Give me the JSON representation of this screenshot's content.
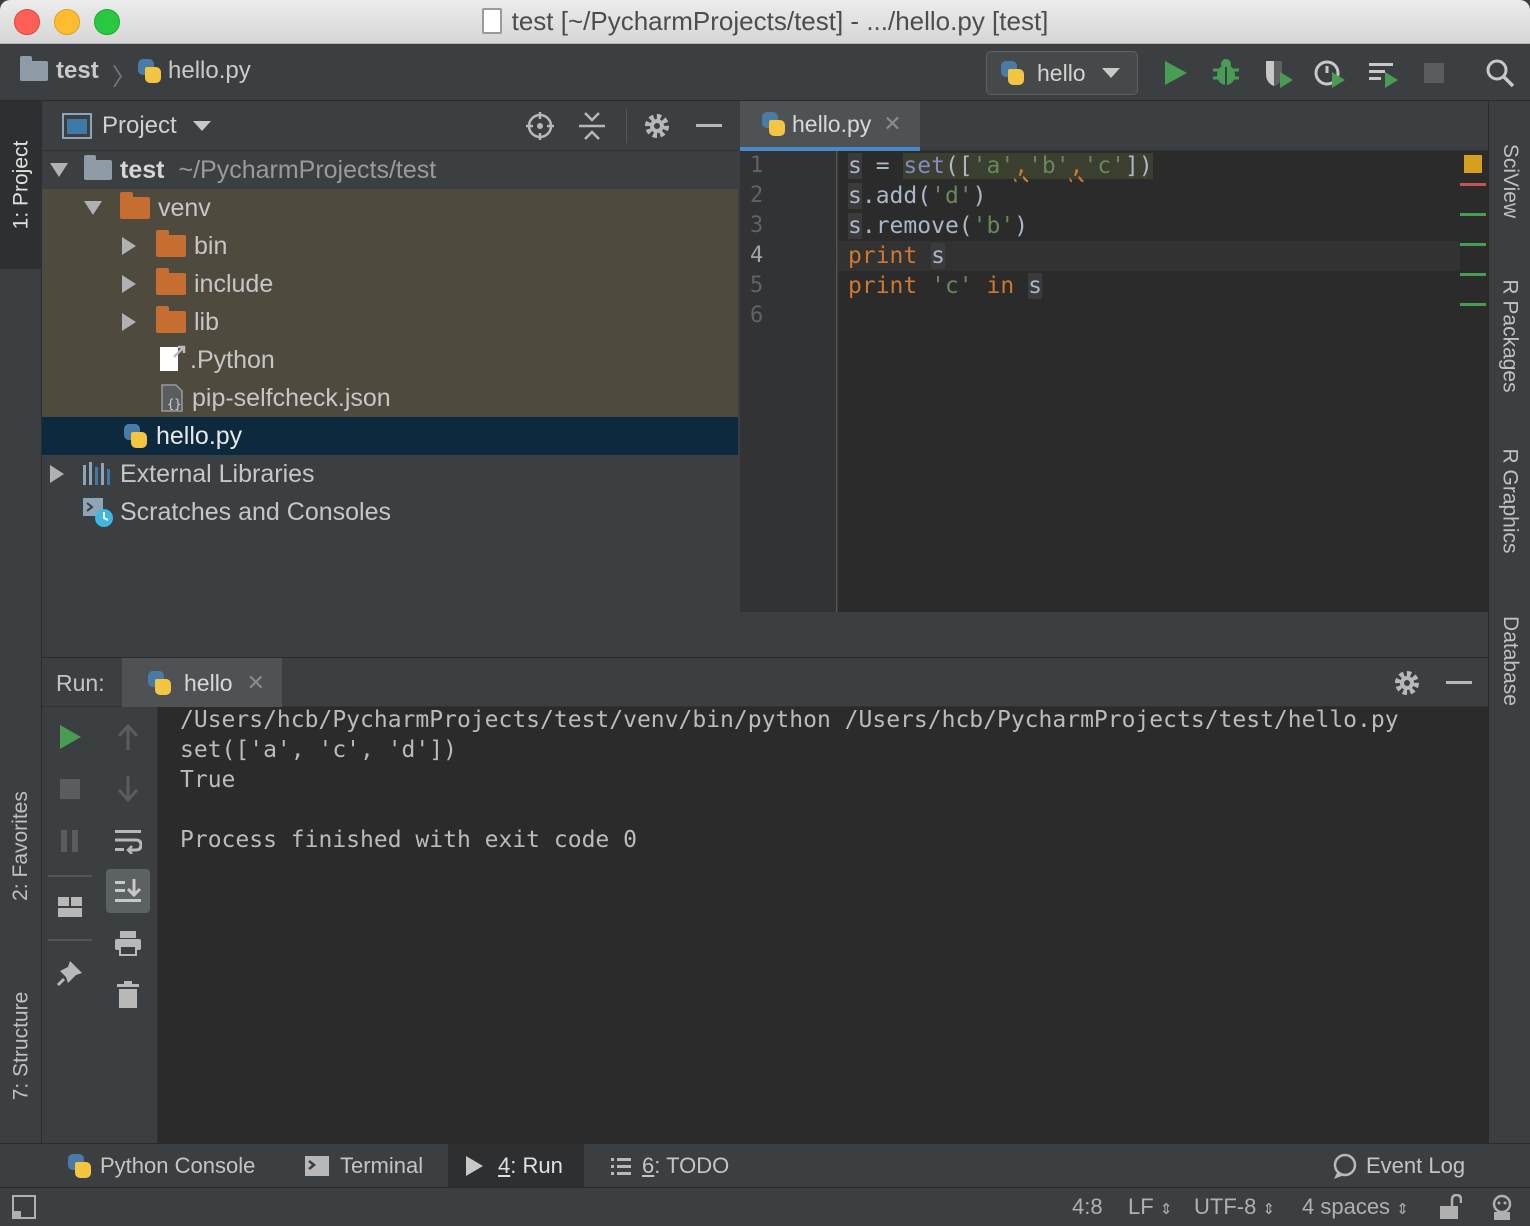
{
  "window": {
    "title": "test [~/PycharmProjects/test] - .../hello.py [test]"
  },
  "nav": {
    "project": "test",
    "file": "hello.py",
    "run_config": "hello"
  },
  "left_tabs": {
    "project": "1: Project",
    "favorites": "2: Favorites",
    "structure": "7: Structure"
  },
  "right_tabs": {
    "sciview": "SciView",
    "rpackages": "R Packages",
    "rgraphics": "R Graphics",
    "database": "Database"
  },
  "project_panel": {
    "title": "Project",
    "tree": [
      {
        "name": "test",
        "path": "~/PycharmProjects/test"
      },
      {
        "name": "venv"
      },
      {
        "name": "bin"
      },
      {
        "name": "include"
      },
      {
        "name": "lib"
      },
      {
        "name": ".Python"
      },
      {
        "name": "pip-selfcheck.json"
      },
      {
        "name": "hello.py"
      },
      {
        "name": "External Libraries"
      },
      {
        "name": "Scratches and Consoles"
      }
    ]
  },
  "editor": {
    "tab": "hello.py",
    "line_numbers": [
      "1",
      "2",
      "3",
      "4",
      "5",
      "6"
    ],
    "lines": [
      {
        "a": "s",
        "b": " = ",
        "c": "set",
        "d": "([",
        "e": "'a'",
        "f": ",",
        "g": "'b'",
        "h": ",",
        "i": "'c'",
        "j": "])"
      },
      {
        "a": "s",
        "b": ".add(",
        "c": "'d'",
        "d": ")"
      },
      {
        "a": "s",
        "b": ".remove(",
        "c": "'b'",
        "d": ")"
      },
      {
        "a": "print",
        "b": " ",
        "c": "s"
      },
      {
        "a": "print",
        "b": " ",
        "c": "'c'",
        "d": " ",
        "e": "in",
        "f": " ",
        "g": "s"
      }
    ]
  },
  "run": {
    "label": "Run:",
    "tab": "hello",
    "output": [
      "/Users/hcb/PycharmProjects/test/venv/bin/python /Users/hcb/PycharmProjects/test/hello.py",
      "set(['a', 'c', 'd'])",
      "True",
      "",
      "Process finished with exit code 0"
    ]
  },
  "bottom_tabs": {
    "python_console": "Python Console",
    "terminal": "Terminal",
    "run_num": "4",
    "run_rest": ": Run",
    "todo_num": "6",
    "todo_rest": ": TODO",
    "event_log": "Event Log"
  },
  "status": {
    "position": "4:8",
    "line_sep": "LF",
    "encoding": "UTF-8",
    "indent": "4 spaces"
  },
  "colors": {
    "accent": "#4a88c7",
    "run_green": "#499c54",
    "folder_orange": "#c66d31",
    "keyword": "#cc7832",
    "string": "#6a8759",
    "builtin": "#8888c6"
  }
}
